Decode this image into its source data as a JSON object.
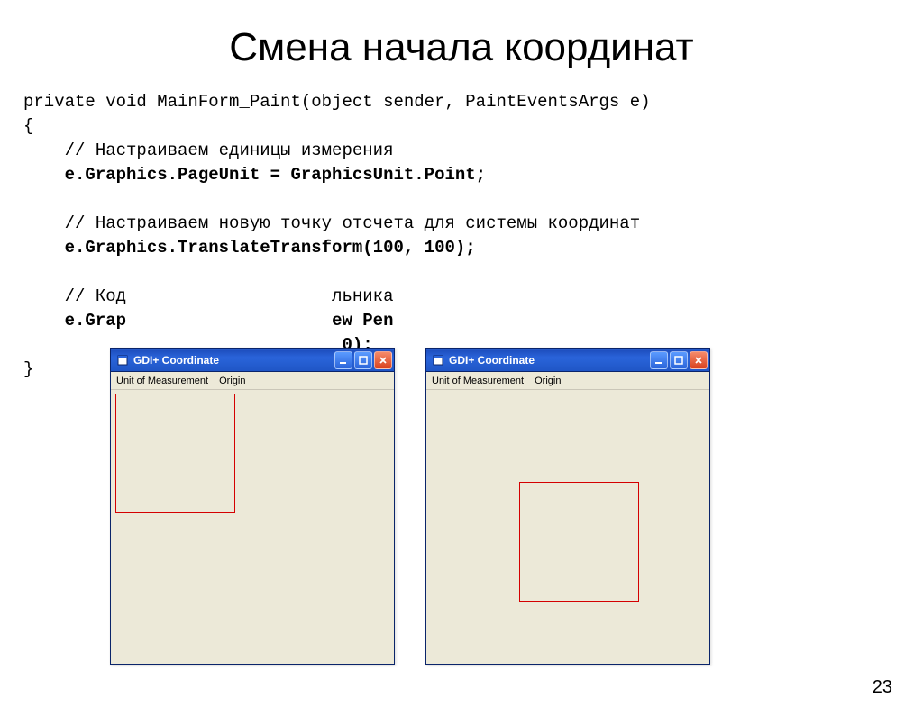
{
  "title": "Смена начала координат",
  "code": {
    "l1": "private void MainForm_Paint(object sender, PaintEventsArgs e)",
    "l2": "{",
    "l3": "    // Настраиваем единицы измерения",
    "l4": "    e.Graphics.PageUnit = GraphicsUnit.Point;",
    "l5": "",
    "l6": "    // Настраиваем новую точку отсчета для системы координат",
    "l7": "    e.Graphics.TranslateTransform(100, 100);",
    "l8": "",
    "l9a": "    // Код",
    "l9b": "льника",
    "l10a": "    e.Grap",
    "l10b": "ew Pen",
    "l11": "0);",
    "l12": "}"
  },
  "window": {
    "title": "GDI+ Coordinate",
    "menu1": "Unit of Measurement",
    "menu2": "Origin"
  },
  "page_number": "23"
}
